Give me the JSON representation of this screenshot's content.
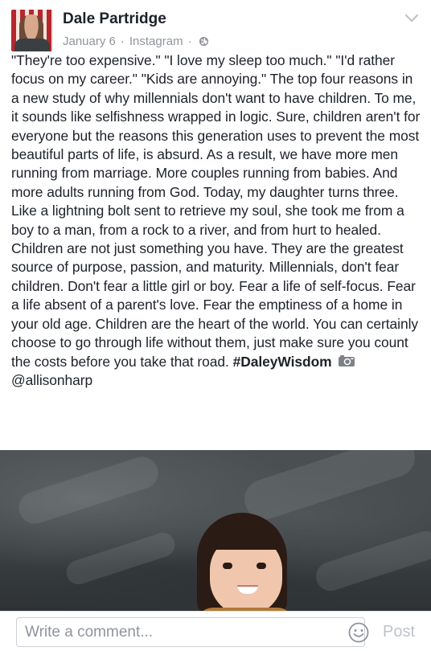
{
  "post": {
    "author": "Dale Partridge",
    "date": "January 6",
    "separator": "·",
    "source": "Instagram",
    "text": "\"They're too expensive.\" \"I love my sleep too much.\" \"I'd rather focus on my career.\" \"Kids are annoying.\" The top four reasons in a new study of why millennials don't want to have children. To me, it sounds like selfishness wrapped in logic. Sure, children aren't for everyone but the reasons this generation uses to prevent the most beautiful parts of life, is absurd. As a result, we have more men running from marriage. More couples running from babies. And more adults running from God. Today, my daughter turns three. Like a lightning bolt sent to retrieve my soul, she took me from a boy to a man, from a rock to a river, and from hurt to healed. Children are not just something you have. They are the greatest source of purpose, passion, and maturity. Millennials, don't fear children. Don't fear a little girl or boy. Fear a life of self-focus. Fear a life absent of a parent's love. Fear the emptiness of a home in your old age. Children are the heart of the world. You can certainly choose to go through life without them, just make sure you count the costs before you take that road.",
    "hashtag": "#DaleyWisdom",
    "credit": "@allisonharp"
  },
  "icons": {
    "privacy": "globe-icon",
    "menu": "chevron-down-icon",
    "camera": "camera-icon",
    "emoji": "smiley-icon"
  },
  "composer": {
    "placeholder": "Write a comment...",
    "post_label": "Post"
  },
  "colors": {
    "text": "#1d2129",
    "meta": "#90949c",
    "post_button_disabled": "#bec3c9"
  }
}
